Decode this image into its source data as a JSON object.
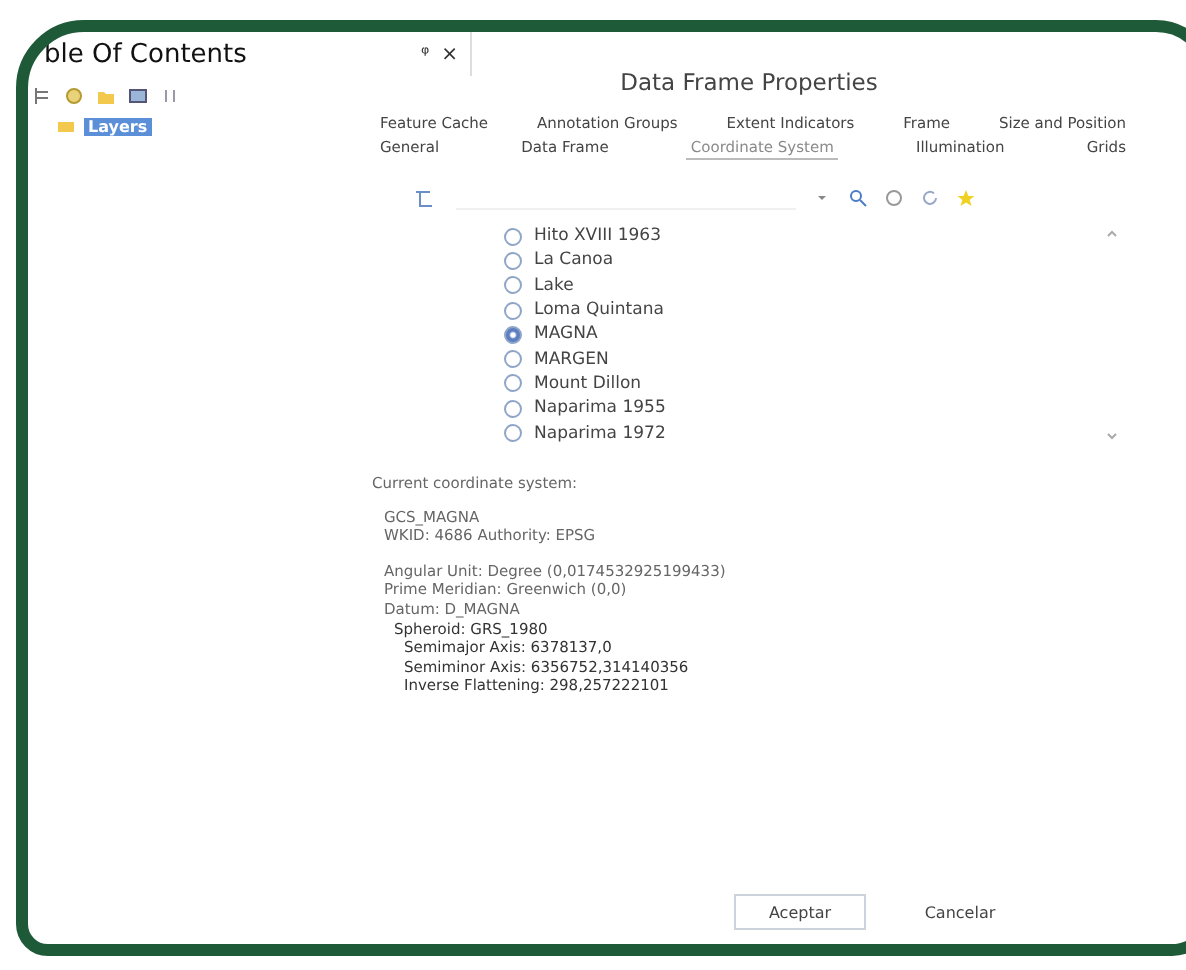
{
  "toc": {
    "title": "ble Of Contents",
    "pin": "ᵠ",
    "close": "×",
    "items": [
      {
        "label": "Layers",
        "selected": true
      }
    ]
  },
  "dialog": {
    "title": "Data Frame Properties",
    "tab_rows": [
      [
        {
          "label": "Feature Cache",
          "selected": false
        },
        {
          "label": "Annotation Groups",
          "selected": false
        },
        {
          "label": "Extent Indicators",
          "selected": false
        },
        {
          "label": "Frame",
          "selected": false
        },
        {
          "label": "Size and Position",
          "selected": false
        }
      ],
      [
        {
          "label": "General",
          "selected": false
        },
        {
          "label": "Data Frame",
          "selected": false
        },
        {
          "label": "Coordinate System",
          "selected": true
        },
        {
          "label": "Illumination",
          "selected": false
        },
        {
          "label": "Grids",
          "selected": false
        }
      ]
    ],
    "systems": [
      {
        "label": "Hito XVIII 1963",
        "selected": false
      },
      {
        "label": "La Canoa",
        "selected": false
      },
      {
        "label": "Lake",
        "selected": false
      },
      {
        "label": "Loma Quintana",
        "selected": false
      },
      {
        "label": "MAGNA",
        "selected": true
      },
      {
        "label": "MARGEN",
        "selected": false
      },
      {
        "label": "Mount Dillon",
        "selected": false
      },
      {
        "label": "Naparima 1955",
        "selected": false
      },
      {
        "label": "Naparima 1972",
        "selected": false
      }
    ],
    "current_label": "Current coordinate system:",
    "details": [
      {
        "lines": [
          {
            "text": "GCS_MAGNA"
          },
          {
            "text": "WKID: 4686 Authority: EPSG"
          }
        ]
      },
      {
        "lines": [
          {
            "text": "Angular Unit: Degree (0,0174532925199433)"
          },
          {
            "text": "Prime Meridian: Greenwich (0,0)"
          },
          {
            "text": "Datum: D_MAGNA",
            "children": [
              {
                "text": "Spheroid: GRS_1980",
                "children": [
                  {
                    "text": "Semimajor Axis: 6378137,0"
                  },
                  {
                    "text": "Semiminor Axis: 6356752,314140356"
                  },
                  {
                    "text": "Inverse Flattening: 298,257222101"
                  }
                ]
              }
            ]
          }
        ]
      }
    ],
    "buttons": [
      {
        "label": "Aceptar",
        "default": true
      },
      {
        "label": "Cancelar",
        "default": false
      }
    ]
  }
}
